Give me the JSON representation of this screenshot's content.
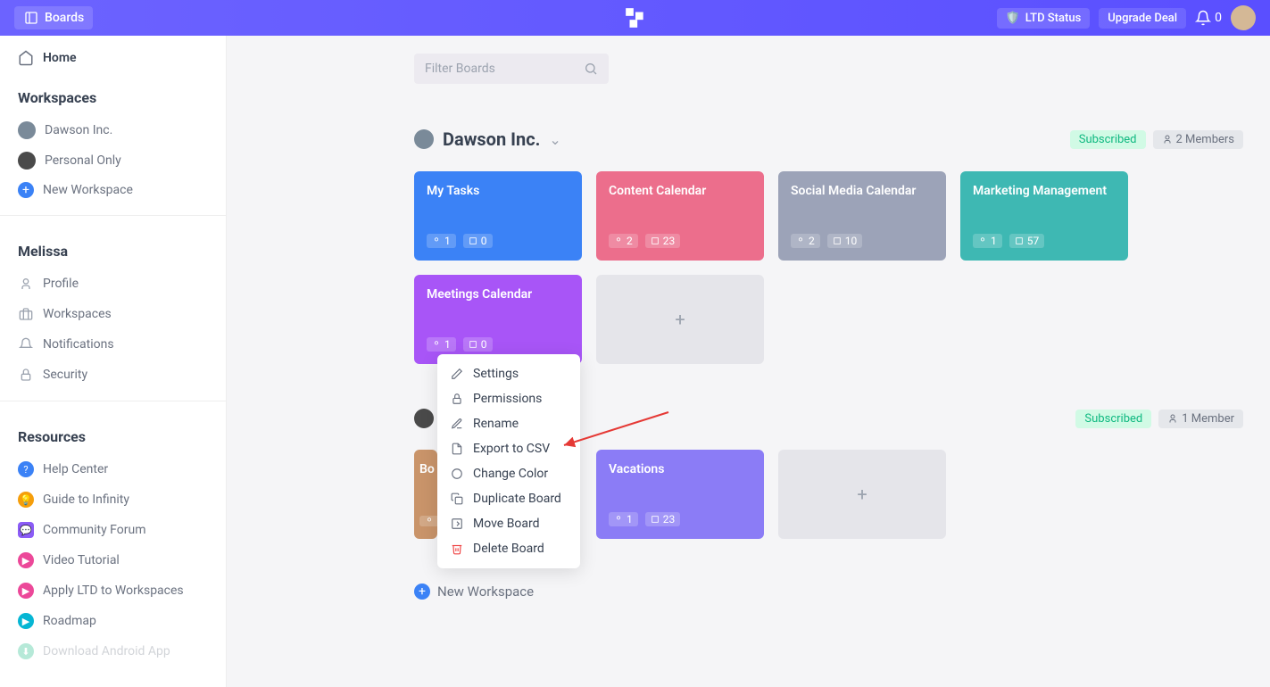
{
  "topbar": {
    "boards": "Boards",
    "ltd_status": "LTD Status",
    "upgrade": "Upgrade Deal",
    "notif_count": "0"
  },
  "sidebar": {
    "home": "Home",
    "workspaces_header": "Workspaces",
    "workspaces": [
      {
        "name": "Dawson Inc."
      },
      {
        "name": "Personal Only"
      }
    ],
    "new_workspace": "New Workspace",
    "user_section": "Melissa",
    "user_links": {
      "profile": "Profile",
      "workspaces": "Workspaces",
      "notifications": "Notifications",
      "security": "Security"
    },
    "resources_header": "Resources",
    "resources": {
      "help": "Help Center",
      "guide": "Guide to Infinity",
      "forum": "Community Forum",
      "video": "Video Tutorial",
      "apply": "Apply LTD to Workspaces",
      "roadmap": "Roadmap",
      "android": "Download Android App"
    }
  },
  "main": {
    "filter_placeholder": "Filter Boards",
    "ws1": {
      "title": "Dawson Inc.",
      "subscribed": "Subscribed",
      "members": "2 Members",
      "boards": [
        {
          "title": "My Tasks",
          "members": "1",
          "items": "0",
          "color": "c-blue"
        },
        {
          "title": "Content Calendar",
          "members": "2",
          "items": "23",
          "color": "c-pink"
        },
        {
          "title": "Social Media Calendar",
          "members": "2",
          "items": "10",
          "color": "c-slate"
        },
        {
          "title": "Marketing Management",
          "members": "1",
          "items": "57",
          "color": "c-teal"
        },
        {
          "title": "Meetings Calendar",
          "members": "1",
          "items": "0",
          "color": "c-purple"
        }
      ]
    },
    "ws2": {
      "subscribed": "Subscribed",
      "members": "1 Member",
      "boards": [
        {
          "title": "Bo",
          "members": "",
          "items": "",
          "color": "c-brown"
        },
        {
          "title": "Vacations",
          "members": "1",
          "items": "23",
          "color": "c-violet"
        }
      ]
    },
    "new_workspace": "New Workspace"
  },
  "context_menu": {
    "settings": "Settings",
    "permissions": "Permissions",
    "rename": "Rename",
    "export": "Export to CSV",
    "color": "Change Color",
    "duplicate": "Duplicate Board",
    "move": "Move Board",
    "delete": "Delete Board"
  }
}
